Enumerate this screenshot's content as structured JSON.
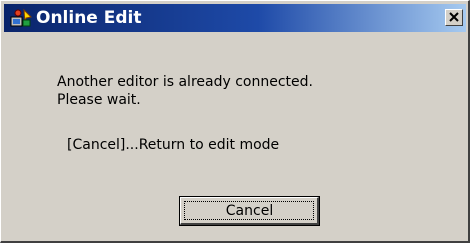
{
  "window": {
    "title": "Online Edit",
    "icon": "online-edit-app-icon",
    "close_icon": "close-icon"
  },
  "message": {
    "line1": "Another editor is already connected.",
    "line2": "Please wait."
  },
  "hint": "[Cancel]...Return to edit mode",
  "buttons": {
    "cancel_label": "Cancel"
  },
  "colors": {
    "titlebar_start": "#0a246a",
    "titlebar_end": "#a6caf0",
    "dialog_face": "#d4d0c8"
  }
}
